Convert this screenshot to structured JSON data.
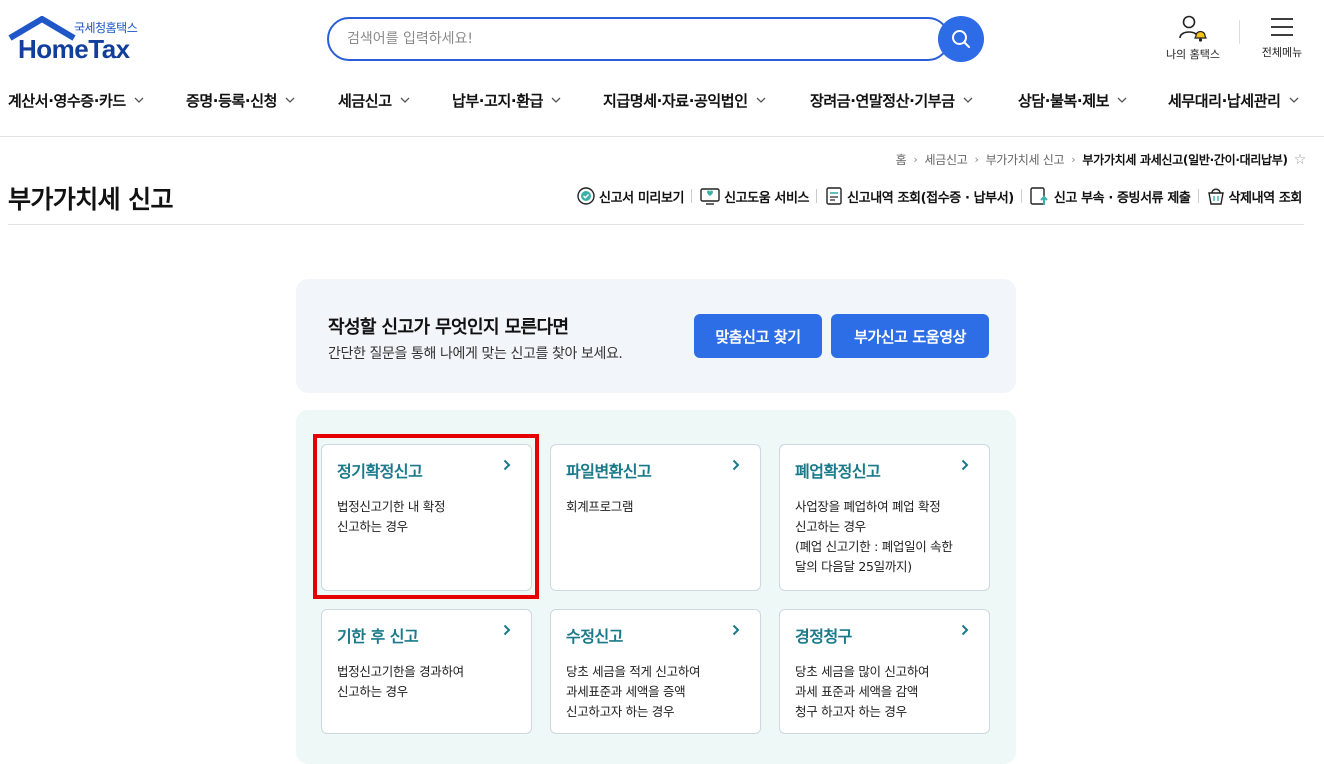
{
  "header": {
    "logo_sub": "국세청홈택스",
    "logo_main": "HomeTax",
    "search_placeholder": "검색어를 입력하세요!",
    "my_hometax": "나의 홈택스",
    "all_menu": "전체메뉴"
  },
  "gnb": [
    {
      "label": "계산서·영수증·카드"
    },
    {
      "label": "증명·등록·신청"
    },
    {
      "label": "세금신고"
    },
    {
      "label": "납부·고지·환급"
    },
    {
      "label": "지급명세·자료·공익법인"
    },
    {
      "label": "장려금·연말정산·기부금"
    },
    {
      "label": "상담·불복·제보"
    },
    {
      "label": "세무대리·납세관리"
    }
  ],
  "breadcrumb": {
    "home": "홈",
    "level1": "세금신고",
    "level2": "부가가치세 신고",
    "current": "부가가치세 과세신고(일반·간이·대리납부)"
  },
  "page": {
    "title": "부가가치세 신고"
  },
  "quick_links": [
    {
      "label": "신고서 미리보기",
      "icon": "preview-check-icon"
    },
    {
      "label": "신고도움 서비스",
      "icon": "help-monitor-icon"
    },
    {
      "label": "신고내역 조회(접수증 · 납부서)",
      "icon": "document-list-icon"
    },
    {
      "label": "신고 부속 · 증빙서류 제출",
      "icon": "upload-document-icon"
    },
    {
      "label": "삭제내역 조회",
      "icon": "trash-basket-icon"
    }
  ],
  "banner": {
    "heading": "작성할 신고가 무엇인지 모른다면",
    "desc": "간단한 질문을 통해 나에게 맞는 신고를 찾아 보세요.",
    "btn1": "맞춤신고 찾기",
    "btn2": "부가신고 도움영상"
  },
  "cards": [
    {
      "title": "정기확정신고",
      "desc": "법정신고기한 내 확정\n신고하는 경우"
    },
    {
      "title": "파일변환신고",
      "desc": "회계프로그램"
    },
    {
      "title": "폐업확정신고",
      "desc": "사업장을 폐업하여 폐업 확정\n신고하는 경우\n(폐업 신고기한 : 폐업일이 속한\n달의 다음달 25일까지)"
    },
    {
      "title": "기한 후 신고",
      "desc": "법정신고기한을 경과하여\n신고하는 경우"
    },
    {
      "title": "수정신고",
      "desc": "당초 세금을 적게 신고하여\n과세표준과 세액을 증액\n신고하고자 하는 경우"
    },
    {
      "title": "경정청구",
      "desc": "당초 세금을 많이 신고하여\n과세 표준과 세액을 감액\n청구 하고자 하는 경우"
    }
  ],
  "colors": {
    "brand_blue": "#2d6ee6",
    "card_title_teal": "#1a7a8a",
    "highlight_red": "#e60000"
  }
}
